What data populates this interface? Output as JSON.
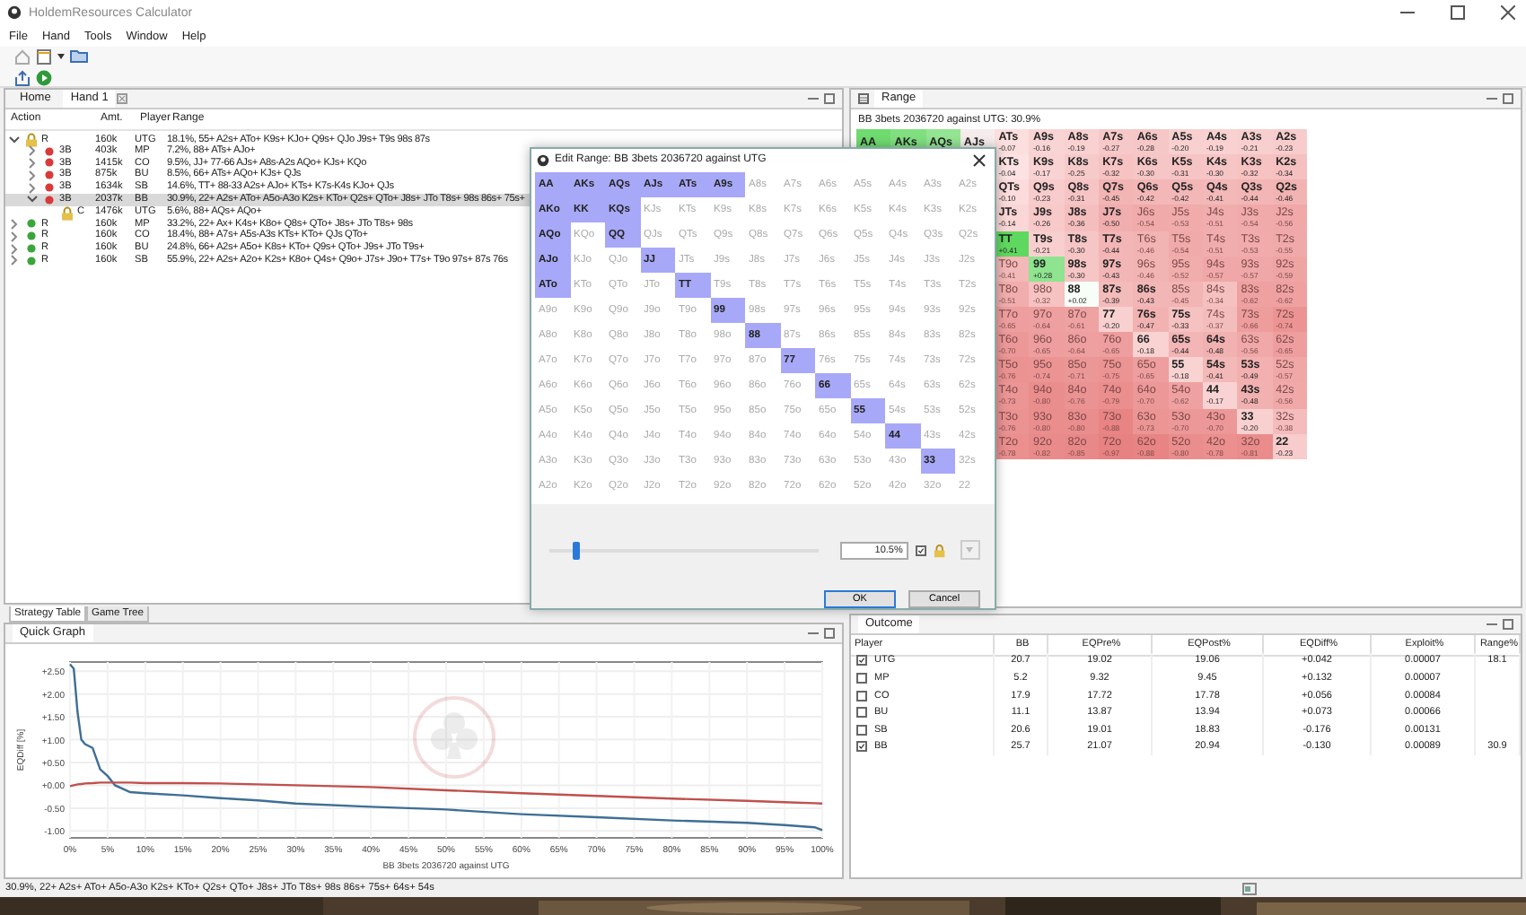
{
  "window": {
    "title": "HoldemResources Calculator"
  },
  "menu": [
    "File",
    "Hand",
    "Tools",
    "Window",
    "Help"
  ],
  "tabs": [
    {
      "label": "Home",
      "selected": false
    },
    {
      "label": "Hand 1",
      "selected": true
    }
  ],
  "tree": {
    "columns": [
      "Action",
      "Amt.",
      "Player",
      "Range"
    ],
    "nodes": [
      {
        "action": "R",
        "amount": "160k",
        "player": "UTG",
        "range": "18.1%, 55+ A2s+ ATo+ K9s+ KJo+ Q9s+ QJo J9s+ T9s 98s 87s",
        "expanded": true,
        "locked": true,
        "selected": false,
        "children": [
          {
            "action": "3B",
            "amount": "403k",
            "player": "MP",
            "range": "7.2%, 88+ ATs+ AJo+",
            "expanded": false,
            "locked": false,
            "selected": false,
            "color": "#d83a3a"
          },
          {
            "action": "3B",
            "amount": "1415k",
            "player": "CO",
            "range": "9.5%, JJ+ 77-66 AJs+ A8s-A2s AQo+ KJs+ KQo",
            "expanded": false,
            "locked": false,
            "selected": false,
            "color": "#d83a3a"
          },
          {
            "action": "3B",
            "amount": "875k",
            "player": "BU",
            "range": "8.5%, 66+ ATs+ AQo+ KJs+ QJs",
            "expanded": false,
            "locked": false,
            "selected": false,
            "color": "#d83a3a"
          },
          {
            "action": "3B",
            "amount": "1634k",
            "player": "SB",
            "range": "14.6%, TT+ 88-33 A2s+ AJo+ KTs+ K7s-K4s KJo+ QJs",
            "expanded": false,
            "locked": false,
            "selected": false,
            "color": "#d83a3a"
          },
          {
            "action": "3B",
            "amount": "2037k",
            "player": "BB",
            "range": "30.9%, 22+ A2s+ ATo+ A5o-A3o K2s+ KTo+ Q2s+ QTo+ J8s+ JTo T8s+ 98s 86s+ 75s+",
            "expanded": true,
            "locked": false,
            "selected": true,
            "color": "#d83a3a",
            "children": [
              {
                "action": "C",
                "amount": "1476k",
                "player": "UTG",
                "range": "5.6%, 88+ AQs+ AQo+",
                "locked": true,
                "selected": false
              }
            ]
          }
        ]
      },
      {
        "action": "R",
        "amount": "160k",
        "player": "MP",
        "range": "33.2%, 22+ Ax+ K4s+ K8o+ Q8s+ QTo+ J8s+ JTo T8s+ 98s",
        "expanded": false,
        "locked": false,
        "selected": false,
        "color": "#3aa63a"
      },
      {
        "action": "R",
        "amount": "160k",
        "player": "CO",
        "range": "18.4%, 88+ A7s+ A5s-A3s KTs+ KTo+ QJs QTo+",
        "expanded": false,
        "locked": false,
        "selected": false,
        "color": "#3aa63a"
      },
      {
        "action": "R",
        "amount": "160k",
        "player": "BU",
        "range": "24.8%, 66+ A2s+ A5o+ K8s+ KTo+ Q9s+ QTo+ J9s+ JTo T9s+",
        "expanded": false,
        "locked": false,
        "selected": false,
        "color": "#3aa63a"
      },
      {
        "action": "R",
        "amount": "160k",
        "player": "SB",
        "range": "55.9%, 22+ A2s+ A2o+ K2s+ K8o+ Q4s+ Q9o+ J7s+ J9o+ T7s+ T9o 97s+ 87s 76s",
        "expanded": false,
        "locked": false,
        "selected": false,
        "color": "#3aa63a"
      }
    ]
  },
  "bottom_tabs": [
    {
      "label": "Strategy Table",
      "selected": true
    },
    {
      "label": "Game Tree",
      "selected": false
    }
  ],
  "quick_graph": {
    "title": "Quick Graph",
    "chart_data": {
      "type": "line",
      "xlabel": "BB 3bets 2036720 against UTG",
      "ylabel": "EQDiff [%]",
      "grid": true,
      "x": [
        0,
        0.5,
        1,
        1.5,
        2,
        3,
        4,
        5,
        6,
        8,
        10,
        15,
        20,
        25,
        30,
        40,
        50,
        60,
        70,
        80,
        90,
        95,
        99,
        100
      ],
      "series": [
        {
          "color": "#3e6e95",
          "values": [
            2.65,
            2.55,
            1.6,
            1.0,
            0.9,
            0.82,
            0.35,
            0.2,
            0.0,
            -0.15,
            -0.17,
            -0.22,
            -0.28,
            -0.33,
            -0.4,
            -0.47,
            -0.53,
            -0.63,
            -0.7,
            -0.77,
            -0.82,
            -0.87,
            -0.92,
            -0.98
          ]
        },
        {
          "color": "#c0504d",
          "values": [
            -0.02,
            0.0,
            0.02,
            0.03,
            0.04,
            0.05,
            0.06,
            0.06,
            0.06,
            0.06,
            0.05,
            0.05,
            0.04,
            0.02,
            0.0,
            -0.04,
            -0.11,
            -0.17,
            -0.23,
            -0.29,
            -0.34,
            -0.37,
            -0.39,
            -0.4
          ]
        }
      ],
      "xlim": [
        0,
        100
      ],
      "ylim": [
        -1.15,
        2.7
      ],
      "xticks": [
        {
          "value": 0,
          "label": "0%"
        },
        {
          "value": 5,
          "label": "5%"
        },
        {
          "value": 10,
          "label": "10%"
        },
        {
          "value": 15,
          "label": "15%"
        },
        {
          "value": 20,
          "label": "20%"
        },
        {
          "value": 25,
          "label": "25%"
        },
        {
          "value": 30,
          "label": "30%"
        },
        {
          "value": 35,
          "label": "35%"
        },
        {
          "value": 40,
          "label": "40%"
        },
        {
          "value": 45,
          "label": "45%"
        },
        {
          "value": 50,
          "label": "50%"
        },
        {
          "value": 55,
          "label": "55%"
        },
        {
          "value": 60,
          "label": "60%"
        },
        {
          "value": 65,
          "label": "65%"
        },
        {
          "value": 70,
          "label": "70%"
        },
        {
          "value": 75,
          "label": "75%"
        },
        {
          "value": 80,
          "label": "80%"
        },
        {
          "value": 85,
          "label": "85%"
        },
        {
          "value": 90,
          "label": "90%"
        },
        {
          "value": 95,
          "label": "95%"
        },
        {
          "value": 100,
          "label": "100%"
        }
      ],
      "yticks": [
        {
          "value": 2.5,
          "label": "+2.50"
        },
        {
          "value": 2,
          "label": "+2.00"
        },
        {
          "value": 1.5,
          "label": "+1.50"
        },
        {
          "value": 1,
          "label": "+1.00"
        },
        {
          "value": 0.5,
          "label": "+0.50"
        },
        {
          "value": 0,
          "label": "+0.00"
        },
        {
          "value": -0.5,
          "label": "-0.50"
        },
        {
          "value": -1,
          "label": "-1.00"
        }
      ]
    }
  },
  "range_panel": {
    "title": "Range",
    "subtitle": "BB 3bets 2036720 against UTG: 30.9%",
    "rows": [
      {
        "cells": [
          {
            "hand": "AA",
            "in_range": true,
            "color": "#6fdc6f"
          },
          {
            "hand": "AKs",
            "in_range": true,
            "color": "#80e080"
          },
          {
            "hand": "AQs",
            "in_range": true,
            "color": "#93e593"
          },
          {
            "hand": "AJs",
            "in_range": true,
            "color": "#f6ecec"
          },
          {
            "hand": "ATs",
            "ev": "-0.07",
            "in_range": true
          },
          {
            "hand": "A9s",
            "ev": "-0.16",
            "in_range": true
          },
          {
            "hand": "A8s",
            "ev": "-0.19",
            "in_range": true
          },
          {
            "hand": "A7s",
            "ev": "-0.27",
            "in_range": true
          },
          {
            "hand": "A6s",
            "ev": "-0.28",
            "in_range": true
          },
          {
            "hand": "A5s",
            "ev": "-0.20",
            "in_range": true
          },
          {
            "hand": "A4s",
            "ev": "-0.19",
            "in_range": true
          },
          {
            "hand": "A3s",
            "ev": "-0.21",
            "in_range": true
          },
          {
            "hand": "A2s",
            "ev": "-0.23",
            "in_range": true
          }
        ]
      },
      {
        "cells": [
          "",
          "",
          "",
          "",
          {
            "hand": "KTs",
            "ev": "-0.04",
            "in_range": true
          },
          {
            "hand": "K9s",
            "ev": "-0.17",
            "in_range": true
          },
          {
            "hand": "K8s",
            "ev": "-0.25",
            "in_range": true
          },
          {
            "hand": "K7s",
            "ev": "-0.32",
            "in_range": true
          },
          {
            "hand": "K6s",
            "ev": "-0.30",
            "in_range": true
          },
          {
            "hand": "K5s",
            "ev": "-0.31",
            "in_range": true
          },
          {
            "hand": "K4s",
            "ev": "-0.30",
            "in_range": true
          },
          {
            "hand": "K3s",
            "ev": "-0.32",
            "in_range": true
          },
          {
            "hand": "K2s",
            "ev": "-0.34",
            "in_range": true
          }
        ]
      },
      {
        "cells": [
          "",
          "",
          "",
          "",
          {
            "hand": "QTs",
            "ev": "-0.10",
            "in_range": true
          },
          {
            "hand": "Q9s",
            "ev": "-0.23",
            "in_range": true
          },
          {
            "hand": "Q8s",
            "ev": "-0.31",
            "in_range": true
          },
          {
            "hand": "Q7s",
            "ev": "-0.45",
            "in_range": true
          },
          {
            "hand": "Q6s",
            "ev": "-0.42",
            "in_range": true
          },
          {
            "hand": "Q5s",
            "ev": "-0.42",
            "in_range": true
          },
          {
            "hand": "Q4s",
            "ev": "-0.41",
            "in_range": true
          },
          {
            "hand": "Q3s",
            "ev": "-0.44",
            "in_range": true
          },
          {
            "hand": "Q2s",
            "ev": "-0.46",
            "in_range": true
          }
        ]
      },
      {
        "cells": [
          "",
          "",
          "",
          "",
          {
            "hand": "JTs",
            "ev": "-0.14",
            "in_range": true
          },
          {
            "hand": "J9s",
            "ev": "-0.26",
            "in_range": true
          },
          {
            "hand": "J8s",
            "ev": "-0.36",
            "in_range": true
          },
          {
            "hand": "J7s",
            "ev": "-0.50",
            "in_range": true
          },
          {
            "hand": "J6s",
            "ev": "-0.54",
            "in_range": false
          },
          {
            "hand": "J5s",
            "ev": "-0.53",
            "in_range": false
          },
          {
            "hand": "J4s",
            "ev": "-0.51",
            "in_range": false
          },
          {
            "hand": "J3s",
            "ev": "-0.54",
            "in_range": false
          },
          {
            "hand": "J2s",
            "ev": "-0.56",
            "in_range": false
          }
        ]
      },
      {
        "cells": [
          "",
          "",
          "",
          "",
          {
            "hand": "TT",
            "ev": "+0.41",
            "in_range": true
          },
          {
            "hand": "T9s",
            "ev": "-0.21",
            "in_range": true
          },
          {
            "hand": "T8s",
            "ev": "-0.30",
            "in_range": true
          },
          {
            "hand": "T7s",
            "ev": "-0.44",
            "in_range": true
          },
          {
            "hand": "T6s",
            "ev": "-0.46",
            "in_range": false
          },
          {
            "hand": "T5s",
            "ev": "-0.54",
            "in_range": false
          },
          {
            "hand": "T4s",
            "ev": "-0.51",
            "in_range": false
          },
          {
            "hand": "T3s",
            "ev": "-0.53",
            "in_range": false
          },
          {
            "hand": "T2s",
            "ev": "-0.55",
            "in_range": false
          }
        ]
      },
      {
        "cells": [
          "",
          "",
          "",
          "",
          {
            "hand": "T9o",
            "ev": "-0.41",
            "in_range": false
          },
          {
            "hand": "99",
            "ev": "+0.28",
            "in_range": true
          },
          {
            "hand": "98s",
            "ev": "-0.30",
            "in_range": true
          },
          {
            "hand": "97s",
            "ev": "-0.43",
            "in_range": true
          },
          {
            "hand": "96s",
            "ev": "-0.46",
            "in_range": false
          },
          {
            "hand": "95s",
            "ev": "-0.52",
            "in_range": false
          },
          {
            "hand": "94s",
            "ev": "-0.57",
            "in_range": false
          },
          {
            "hand": "93s",
            "ev": "-0.57",
            "in_range": false
          },
          {
            "hand": "92s",
            "ev": "-0.59",
            "in_range": false
          }
        ]
      },
      {
        "cells": [
          "",
          "",
          "",
          "",
          {
            "hand": "T8o",
            "ev": "-0.51",
            "in_range": false
          },
          {
            "hand": "98o",
            "ev": "-0.32",
            "in_range": false
          },
          {
            "hand": "88",
            "ev": "+0.02",
            "in_range": true
          },
          {
            "hand": "87s",
            "ev": "-0.39",
            "in_range": true
          },
          {
            "hand": "86s",
            "ev": "-0.43",
            "in_range": true
          },
          {
            "hand": "85s",
            "ev": "-0.45",
            "in_range": false
          },
          {
            "hand": "84s",
            "ev": "-0.34",
            "in_range": false
          },
          {
            "hand": "83s",
            "ev": "-0.62",
            "in_range": false
          },
          {
            "hand": "82s",
            "ev": "-0.62",
            "in_range": false
          }
        ]
      },
      {
        "cells": [
          "",
          "",
          "",
          "",
          {
            "hand": "T7o",
            "ev": "-0.65",
            "in_range": false
          },
          {
            "hand": "97o",
            "ev": "-0.64",
            "in_range": false
          },
          {
            "hand": "87o",
            "ev": "-0.61",
            "in_range": false
          },
          {
            "hand": "77",
            "ev": "-0.20",
            "in_range": true
          },
          {
            "hand": "76s",
            "ev": "-0.47",
            "in_range": true
          },
          {
            "hand": "75s",
            "ev": "-0.33",
            "in_range": true
          },
          {
            "hand": "74s",
            "ev": "-0.37",
            "in_range": false
          },
          {
            "hand": "73s",
            "ev": "-0.66",
            "in_range": false
          },
          {
            "hand": "72s",
            "ev": "-0.74",
            "in_range": false
          }
        ]
      },
      {
        "cells": [
          "",
          "",
          "",
          "",
          {
            "hand": "T6o",
            "ev": "-0.70",
            "in_range": false
          },
          {
            "hand": "96o",
            "ev": "-0.65",
            "in_range": false
          },
          {
            "hand": "86o",
            "ev": "-0.64",
            "in_range": false
          },
          {
            "hand": "76o",
            "ev": "-0.65",
            "in_range": false
          },
          {
            "hand": "66",
            "ev": "-0.18",
            "in_range": true
          },
          {
            "hand": "65s",
            "ev": "-0.44",
            "in_range": true
          },
          {
            "hand": "64s",
            "ev": "-0.48",
            "in_range": true
          },
          {
            "hand": "63s",
            "ev": "-0.56",
            "in_range": false
          },
          {
            "hand": "62s",
            "ev": "-0.65",
            "in_range": false
          }
        ]
      },
      {
        "cells": [
          "",
          "",
          "",
          "",
          {
            "hand": "T5o",
            "ev": "-0.76",
            "in_range": false
          },
          {
            "hand": "95o",
            "ev": "-0.74",
            "in_range": false
          },
          {
            "hand": "85o",
            "ev": "-0.71",
            "in_range": false
          },
          {
            "hand": "75o",
            "ev": "-0.75",
            "in_range": false
          },
          {
            "hand": "65o",
            "ev": "-0.65",
            "in_range": false
          },
          {
            "hand": "55",
            "ev": "-0.18",
            "in_range": true
          },
          {
            "hand": "54s",
            "ev": "-0.41",
            "in_range": true
          },
          {
            "hand": "53s",
            "ev": "-0.49",
            "in_range": true
          },
          {
            "hand": "52s",
            "ev": "-0.57",
            "in_range": false
          }
        ]
      },
      {
        "cells": [
          "",
          "",
          "",
          "",
          {
            "hand": "T4o",
            "ev": "-0.73",
            "in_range": false
          },
          {
            "hand": "94o",
            "ev": "-0.80",
            "in_range": false
          },
          {
            "hand": "84o",
            "ev": "-0.76",
            "in_range": false
          },
          {
            "hand": "74o",
            "ev": "-0.79",
            "in_range": false
          },
          {
            "hand": "64o",
            "ev": "-0.70",
            "in_range": false
          },
          {
            "hand": "54o",
            "ev": "-0.62",
            "in_range": false
          },
          {
            "hand": "44",
            "ev": "-0.17",
            "in_range": true
          },
          {
            "hand": "43s",
            "ev": "-0.48",
            "in_range": true
          },
          {
            "hand": "42s",
            "ev": "-0.56",
            "in_range": false
          }
        ]
      },
      {
        "cells": [
          "",
          "",
          "",
          "",
          {
            "hand": "T3o",
            "ev": "-0.76",
            "in_range": false
          },
          {
            "hand": "93o",
            "ev": "-0.80",
            "in_range": false
          },
          {
            "hand": "83o",
            "ev": "-0.80",
            "in_range": false
          },
          {
            "hand": "73o",
            "ev": "-0.88",
            "in_range": false
          },
          {
            "hand": "63o",
            "ev": "-0.73",
            "in_range": false
          },
          {
            "hand": "53o",
            "ev": "-0.70",
            "in_range": false
          },
          {
            "hand": "43o",
            "ev": "-0.70",
            "in_range": false
          },
          {
            "hand": "33",
            "ev": "-0.20",
            "in_range": true
          },
          {
            "hand": "32s",
            "ev": "-0.38",
            "in_range": false
          }
        ]
      },
      {
        "cells": [
          "",
          "",
          "",
          "",
          {
            "hand": "T2o",
            "ev": "-0.78",
            "in_range": false
          },
          {
            "hand": "92o",
            "ev": "-0.82",
            "in_range": false
          },
          {
            "hand": "82o",
            "ev": "-0.85",
            "in_range": false
          },
          {
            "hand": "72o",
            "ev": "-0.97",
            "in_range": false
          },
          {
            "hand": "62o",
            "ev": "-0.88",
            "in_range": false
          },
          {
            "hand": "52o",
            "ev": "-0.80",
            "in_range": false
          },
          {
            "hand": "42o",
            "ev": "-0.78",
            "in_range": false
          },
          {
            "hand": "32o",
            "ev": "-0.81",
            "in_range": false
          },
          {
            "hand": "22",
            "ev": "-0.23",
            "in_range": true
          }
        ]
      }
    ]
  },
  "outcome": {
    "title": "Outcome",
    "columns": [
      "Player",
      "BB",
      "EQPre%",
      "EQPost%",
      "EQDiff%",
      "Exploit%",
      "Range%"
    ],
    "rows": [
      {
        "checked": true,
        "player": "UTG",
        "bb": "20.7",
        "eq_pre": "19.02",
        "eq_post": "19.06",
        "eq_diff": "+0.042",
        "exploit": "0.00007",
        "range": "18.1"
      },
      {
        "checked": false,
        "player": "MP",
        "bb": "5.2",
        "eq_pre": "9.32",
        "eq_post": "9.45",
        "eq_diff": "+0.132",
        "exploit": "0.00007"
      },
      {
        "checked": false,
        "player": "CO",
        "bb": "17.9",
        "eq_pre": "17.72",
        "eq_post": "17.78",
        "eq_diff": "+0.056",
        "exploit": "0.00084"
      },
      {
        "checked": false,
        "player": "BU",
        "bb": "11.1",
        "eq_pre": "13.87",
        "eq_post": "13.94",
        "eq_diff": "+0.073",
        "exploit": "0.00066"
      },
      {
        "checked": false,
        "player": "SB",
        "bb": "20.6",
        "eq_pre": "19.01",
        "eq_post": "18.83",
        "eq_diff": "-0.176",
        "exploit": "0.00131"
      },
      {
        "checked": true,
        "player": "BB",
        "bb": "25.7",
        "eq_pre": "21.07",
        "eq_post": "20.94",
        "eq_diff": "-0.130",
        "exploit": "0.00089",
        "range": "30.9"
      }
    ]
  },
  "status_bar": "30.9%, 22+ A2s+ ATo+ A5o-A3o K2s+ KTo+ Q2s+ QTo+ J8s+ JTo T8s+ 98s 86s+ 75s+ 64s+ 54s",
  "dialog": {
    "title": "Edit Range: BB 3bets 2036720 against UTG",
    "grid": [
      [
        {
          "hand": "AA",
          "selected": true
        },
        {
          "hand": "AKs",
          "selected": true
        },
        {
          "hand": "AQs",
          "selected": true
        },
        {
          "hand": "AJs",
          "selected": true
        },
        {
          "hand": "ATs",
          "selected": true
        },
        {
          "hand": "A9s",
          "selected": true
        },
        {
          "hand": "A8s",
          "selected": false
        },
        {
          "hand": "A7s",
          "selected": false
        },
        {
          "hand": "A6s",
          "selected": false
        },
        {
          "hand": "A5s",
          "selected": false
        },
        {
          "hand": "A4s",
          "selected": false
        },
        {
          "hand": "A3s",
          "selected": false
        },
        {
          "hand": "A2s",
          "selected": false
        }
      ],
      [
        {
          "hand": "AKo",
          "selected": true
        },
        {
          "hand": "KK",
          "selected": true
        },
        {
          "hand": "KQs",
          "selected": true
        },
        {
          "hand": "KJs",
          "selected": false
        },
        {
          "hand": "KTs",
          "selected": false
        },
        {
          "hand": "K9s",
          "selected": false
        },
        {
          "hand": "K8s",
          "selected": false
        },
        {
          "hand": "K7s",
          "selected": false
        },
        {
          "hand": "K6s",
          "selected": false
        },
        {
          "hand": "K5s",
          "selected": false
        },
        {
          "hand": "K4s",
          "selected": false
        },
        {
          "hand": "K3s",
          "selected": false
        },
        {
          "hand": "K2s",
          "selected": false
        }
      ],
      [
        {
          "hand": "AQo",
          "selected": true
        },
        {
          "hand": "KQo",
          "selected": false
        },
        {
          "hand": "QQ",
          "selected": true
        },
        {
          "hand": "QJs",
          "selected": false
        },
        {
          "hand": "QTs",
          "selected": false
        },
        {
          "hand": "Q9s",
          "selected": false
        },
        {
          "hand": "Q8s",
          "selected": false
        },
        {
          "hand": "Q7s",
          "selected": false
        },
        {
          "hand": "Q6s",
          "selected": false
        },
        {
          "hand": "Q5s",
          "selected": false
        },
        {
          "hand": "Q4s",
          "selected": false
        },
        {
          "hand": "Q3s",
          "selected": false
        },
        {
          "hand": "Q2s",
          "selected": false
        }
      ],
      [
        {
          "hand": "AJo",
          "selected": true
        },
        {
          "hand": "KJo",
          "selected": false
        },
        {
          "hand": "QJo",
          "selected": false
        },
        {
          "hand": "JJ",
          "selected": true
        },
        {
          "hand": "JTs",
          "selected": false
        },
        {
          "hand": "J9s",
          "selected": false
        },
        {
          "hand": "J8s",
          "selected": false
        },
        {
          "hand": "J7s",
          "selected": false
        },
        {
          "hand": "J6s",
          "selected": false
        },
        {
          "hand": "J5s",
          "selected": false
        },
        {
          "hand": "J4s",
          "selected": false
        },
        {
          "hand": "J3s",
          "selected": false
        },
        {
          "hand": "J2s",
          "selected": false
        }
      ],
      [
        {
          "hand": "ATo",
          "selected": true
        },
        {
          "hand": "KTo",
          "selected": false
        },
        {
          "hand": "QTo",
          "selected": false
        },
        {
          "hand": "JTo",
          "selected": false
        },
        {
          "hand": "TT",
          "selected": true
        },
        {
          "hand": "T9s",
          "selected": false
        },
        {
          "hand": "T8s",
          "selected": false
        },
        {
          "hand": "T7s",
          "selected": false
        },
        {
          "hand": "T6s",
          "selected": false
        },
        {
          "hand": "T5s",
          "selected": false
        },
        {
          "hand": "T4s",
          "selected": false
        },
        {
          "hand": "T3s",
          "selected": false
        },
        {
          "hand": "T2s",
          "selected": false
        }
      ],
      [
        {
          "hand": "A9o",
          "selected": false
        },
        {
          "hand": "K9o",
          "selected": false
        },
        {
          "hand": "Q9o",
          "selected": false
        },
        {
          "hand": "J9o",
          "selected": false
        },
        {
          "hand": "T9o",
          "selected": false
        },
        {
          "hand": "99",
          "selected": true
        },
        {
          "hand": "98s",
          "selected": false
        },
        {
          "hand": "97s",
          "selected": false
        },
        {
          "hand": "96s",
          "selected": false
        },
        {
          "hand": "95s",
          "selected": false
        },
        {
          "hand": "94s",
          "selected": false
        },
        {
          "hand": "93s",
          "selected": false
        },
        {
          "hand": "92s",
          "selected": false
        }
      ],
      [
        {
          "hand": "A8o",
          "selected": false
        },
        {
          "hand": "K8o",
          "selected": false
        },
        {
          "hand": "Q8o",
          "selected": false
        },
        {
          "hand": "J8o",
          "selected": false
        },
        {
          "hand": "T8o",
          "selected": false
        },
        {
          "hand": "98o",
          "selected": false
        },
        {
          "hand": "88",
          "selected": true
        },
        {
          "hand": "87s",
          "selected": false
        },
        {
          "hand": "86s",
          "selected": false
        },
        {
          "hand": "85s",
          "selected": false
        },
        {
          "hand": "84s",
          "selected": false
        },
        {
          "hand": "83s",
          "selected": false
        },
        {
          "hand": "82s",
          "selected": false
        }
      ],
      [
        {
          "hand": "A7o",
          "selected": false
        },
        {
          "hand": "K7o",
          "selected": false
        },
        {
          "hand": "Q7o",
          "selected": false
        },
        {
          "hand": "J7o",
          "selected": false
        },
        {
          "hand": "T7o",
          "selected": false
        },
        {
          "hand": "97o",
          "selected": false
        },
        {
          "hand": "87o",
          "selected": false
        },
        {
          "hand": "77",
          "selected": true
        },
        {
          "hand": "76s",
          "selected": false
        },
        {
          "hand": "75s",
          "selected": false
        },
        {
          "hand": "74s",
          "selected": false
        },
        {
          "hand": "73s",
          "selected": false
        },
        {
          "hand": "72s",
          "selected": false
        }
      ],
      [
        {
          "hand": "A6o",
          "selected": false
        },
        {
          "hand": "K6o",
          "selected": false
        },
        {
          "hand": "Q6o",
          "selected": false
        },
        {
          "hand": "J6o",
          "selected": false
        },
        {
          "hand": "T6o",
          "selected": false
        },
        {
          "hand": "96o",
          "selected": false
        },
        {
          "hand": "86o",
          "selected": false
        },
        {
          "hand": "76o",
          "selected": false
        },
        {
          "hand": "66",
          "selected": true
        },
        {
          "hand": "65s",
          "selected": false
        },
        {
          "hand": "64s",
          "selected": false
        },
        {
          "hand": "63s",
          "selected": false
        },
        {
          "hand": "62s",
          "selected": false
        }
      ],
      [
        {
          "hand": "A5o",
          "selected": false
        },
        {
          "hand": "K5o",
          "selected": false
        },
        {
          "hand": "Q5o",
          "selected": false
        },
        {
          "hand": "J5o",
          "selected": false
        },
        {
          "hand": "T5o",
          "selected": false
        },
        {
          "hand": "95o",
          "selected": false
        },
        {
          "hand": "85o",
          "selected": false
        },
        {
          "hand": "75o",
          "selected": false
        },
        {
          "hand": "65o",
          "selected": false
        },
        {
          "hand": "55",
          "selected": true
        },
        {
          "hand": "54s",
          "selected": false
        },
        {
          "hand": "53s",
          "selected": false
        },
        {
          "hand": "52s",
          "selected": false
        }
      ],
      [
        {
          "hand": "A4o",
          "selected": false
        },
        {
          "hand": "K4o",
          "selected": false
        },
        {
          "hand": "Q4o",
          "selected": false
        },
        {
          "hand": "J4o",
          "selected": false
        },
        {
          "hand": "T4o",
          "selected": false
        },
        {
          "hand": "94o",
          "selected": false
        },
        {
          "hand": "84o",
          "selected": false
        },
        {
          "hand": "74o",
          "selected": false
        },
        {
          "hand": "64o",
          "selected": false
        },
        {
          "hand": "54o",
          "selected": false
        },
        {
          "hand": "44",
          "selected": true
        },
        {
          "hand": "43s",
          "selected": false
        },
        {
          "hand": "42s",
          "selected": false
        }
      ],
      [
        {
          "hand": "A3o",
          "selected": false
        },
        {
          "hand": "K3o",
          "selected": false
        },
        {
          "hand": "Q3o",
          "selected": false
        },
        {
          "hand": "J3o",
          "selected": false
        },
        {
          "hand": "T3o",
          "selected": false
        },
        {
          "hand": "93o",
          "selected": false
        },
        {
          "hand": "83o",
          "selected": false
        },
        {
          "hand": "73o",
          "selected": false
        },
        {
          "hand": "63o",
          "selected": false
        },
        {
          "hand": "53o",
          "selected": false
        },
        {
          "hand": "43o",
          "selected": false
        },
        {
          "hand": "33",
          "selected": true
        },
        {
          "hand": "32s",
          "selected": false
        }
      ],
      [
        {
          "hand": "A2o",
          "selected": false
        },
        {
          "hand": "K2o",
          "selected": false
        },
        {
          "hand": "Q2o",
          "selected": false
        },
        {
          "hand": "J2o",
          "selected": false
        },
        {
          "hand": "T2o",
          "selected": false
        },
        {
          "hand": "92o",
          "selected": false
        },
        {
          "hand": "82o",
          "selected": false
        },
        {
          "hand": "72o",
          "selected": false
        },
        {
          "hand": "62o",
          "selected": false
        },
        {
          "hand": "52o",
          "selected": false
        },
        {
          "hand": "42o",
          "selected": false
        },
        {
          "hand": "32o",
          "selected": false
        },
        {
          "hand": "22",
          "selected": false
        }
      ]
    ],
    "slider": {
      "level": 0.1
    },
    "percent": "10.5%",
    "lock": {
      "checked": true
    },
    "buttons": [
      "OK",
      "Cancel"
    ]
  }
}
